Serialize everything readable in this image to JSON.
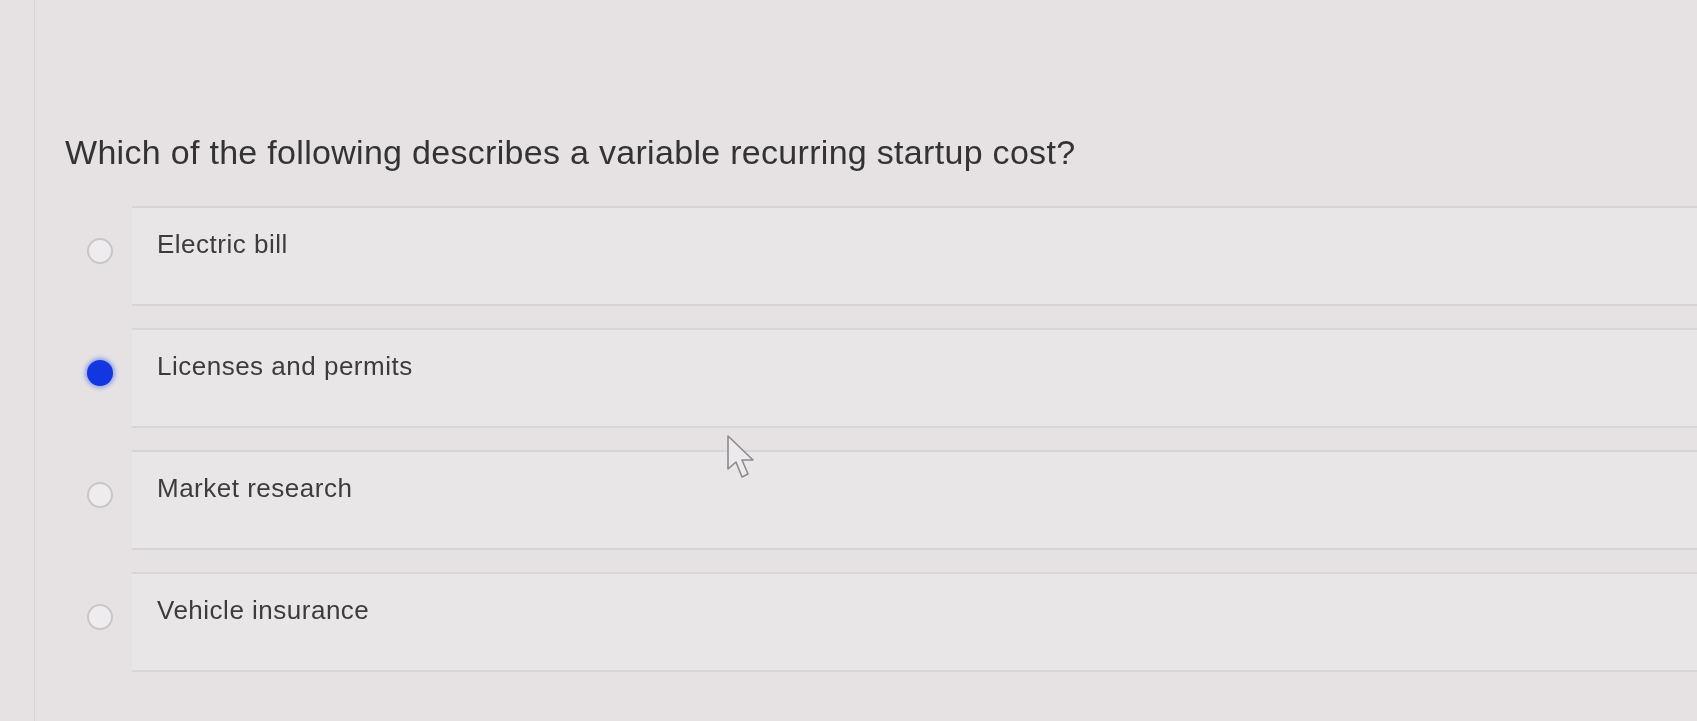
{
  "question": "Which of the following describes a variable recurring startup cost?",
  "options": [
    {
      "label": "Electric bill",
      "selected": false
    },
    {
      "label": "Licenses and permits",
      "selected": true
    },
    {
      "label": "Market research",
      "selected": false
    },
    {
      "label": "Vehicle insurance",
      "selected": false
    }
  ]
}
